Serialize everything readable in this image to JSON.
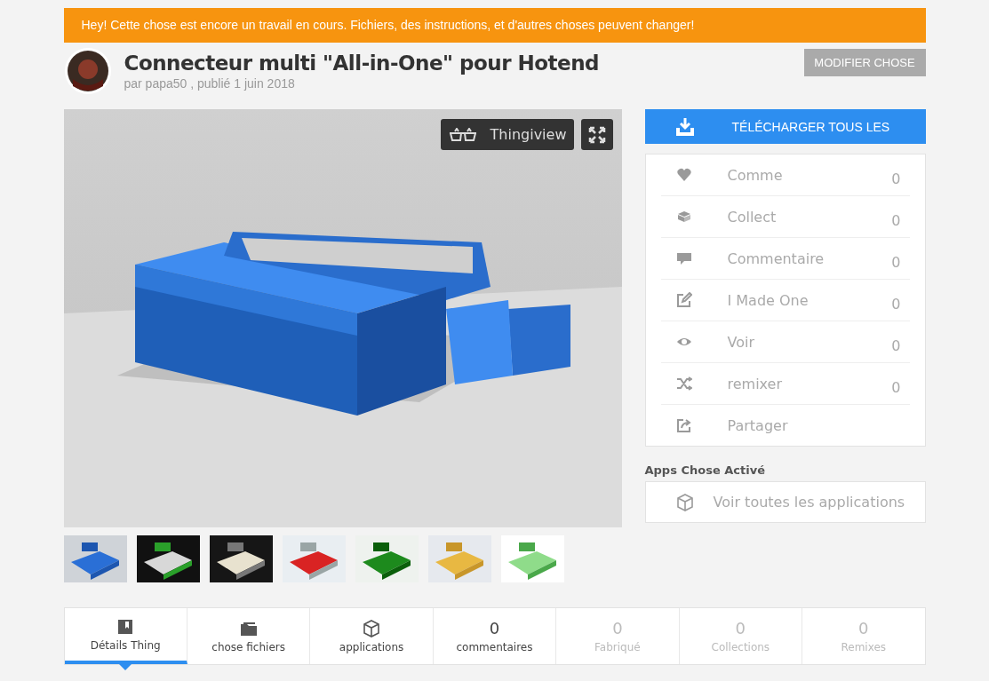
{
  "banner": "Hey! Cette chose est encore un travail en cours. Fichiers, des instructions, et d'autres choses peuvent changer!",
  "title": "Connecteur multi \"All-in-One\" pour Hotend",
  "byline": "par papa50 , publié 1 juin 2018",
  "edit_button": "MODIFIER CHOSE",
  "viewer": {
    "kind": "picture",
    "mode_button": "Thingiview"
  },
  "download_button": "TÉLÉCHARGER TOUS LES",
  "stats": [
    {
      "label": "Comme",
      "count": "0"
    },
    {
      "label": "Collect",
      "count": "0"
    },
    {
      "label": "Commentaire",
      "count": "0"
    },
    {
      "label": "I Made One",
      "count": "0"
    },
    {
      "label": "Voir",
      "count": "0"
    },
    {
      "label": "remixer",
      "count": "0"
    },
    {
      "label": "Partager"
    }
  ],
  "apps_heading": "Apps Chose Activé",
  "apps_link": "Voir toutes les applications",
  "tabs": [
    {
      "kind": "icon",
      "label": "Détails Thing",
      "selected": true,
      "disabled": false
    },
    {
      "kind": "icon",
      "label": "chose fichiers",
      "selected": false,
      "disabled": false
    },
    {
      "kind": "icon",
      "label": "applications",
      "selected": false,
      "disabled": false
    },
    {
      "kind": "count",
      "count": "0",
      "label": "commentaires",
      "selected": false,
      "disabled": false
    },
    {
      "kind": "count",
      "count": "0",
      "label": "Fabriqué",
      "selected": false,
      "disabled": true
    },
    {
      "kind": "count",
      "count": "0",
      "label": "Collections",
      "selected": false,
      "disabled": true
    },
    {
      "kind": "count",
      "count": "0",
      "label": "Remixes",
      "selected": false,
      "disabled": true
    }
  ]
}
